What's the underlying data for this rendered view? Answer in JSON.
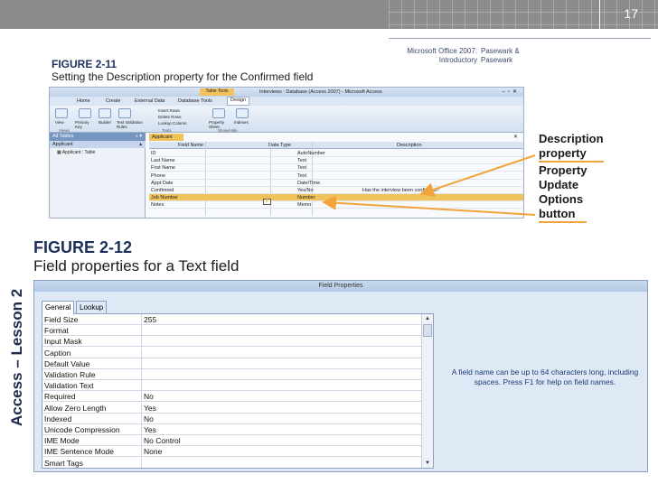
{
  "slide": {
    "number": "17",
    "book_title_line1": "Microsoft Office 2007:",
    "book_title_line2": "Introductory",
    "book_authors_line1": "Pasewark &",
    "book_authors_line2": "Pasewark",
    "side_label": "Access – Lesson 2"
  },
  "figure1": {
    "number": "FIGURE 2-11",
    "caption": "Setting the Description property for the Confirmed field",
    "screenshot": {
      "context_tab": "Table Tools",
      "window_title": "Interviews : Database (Access 2007) - Microsoft Access",
      "ribbon_tabs": [
        "Home",
        "Create",
        "External Data",
        "Database Tools",
        "Design"
      ],
      "ribbon_buttons": {
        "view": "View",
        "primary_key": "Primary Key",
        "builder": "Builder",
        "test_validation": "Test Validation Rules",
        "insert_rows": "Insert Rows",
        "delete_rows": "Delete Rows",
        "lookup_column": "Lookup Column",
        "property_sheet": "Property Sheet",
        "indexes": "Indexes"
      },
      "ribbon_groups": [
        "Views",
        "Tools",
        "Show/Hide"
      ],
      "nav_header": "All Tables",
      "nav_group": "Applicant",
      "nav_item": "Applicant : Table",
      "doc_tab": "Applicant",
      "columns": [
        "Field Name",
        "Data Type",
        "Description"
      ],
      "rows": [
        {
          "name": "ID",
          "type": "AutoNumber",
          "desc": ""
        },
        {
          "name": "Last Name",
          "type": "Text",
          "desc": ""
        },
        {
          "name": "First Name",
          "type": "Text",
          "desc": ""
        },
        {
          "name": "Phone",
          "type": "Text",
          "desc": ""
        },
        {
          "name": "Appt Date",
          "type": "Date/Time",
          "desc": ""
        },
        {
          "name": "Confirmed",
          "type": "Yes/No",
          "desc": "Has the interview been confirmed?"
        },
        {
          "name": "Job Number",
          "type": "Number",
          "desc": ""
        },
        {
          "name": "Notes",
          "type": "Memo",
          "desc": ""
        }
      ]
    },
    "callouts": {
      "description_line1": "Description",
      "description_line2": "property",
      "puo_line1": "Property",
      "puo_line2": "Update",
      "puo_line3": "Options",
      "puo_line4": "button"
    },
    "arrow_color": "#f0a43a"
  },
  "figure2": {
    "number": "FIGURE 2-12",
    "caption": "Field properties for a Text field",
    "panel_title": "Field Properties",
    "tabs": [
      "General",
      "Lookup"
    ],
    "properties": [
      {
        "key": "Field Size",
        "value": "255"
      },
      {
        "key": "Format",
        "value": ""
      },
      {
        "key": "Input Mask",
        "value": ""
      },
      {
        "key": "Caption",
        "value": ""
      },
      {
        "key": "Default Value",
        "value": ""
      },
      {
        "key": "Validation Rule",
        "value": ""
      },
      {
        "key": "Validation Text",
        "value": ""
      },
      {
        "key": "Required",
        "value": "No"
      },
      {
        "key": "Allow Zero Length",
        "value": "Yes"
      },
      {
        "key": "Indexed",
        "value": "No"
      },
      {
        "key": "Unicode Compression",
        "value": "Yes"
      },
      {
        "key": "IME Mode",
        "value": "No Control"
      },
      {
        "key": "IME Sentence Mode",
        "value": "None"
      },
      {
        "key": "Smart Tags",
        "value": ""
      }
    ],
    "help_text": "A field name can be up to 64 characters long, including spaces. Press F1 for help on field names."
  }
}
